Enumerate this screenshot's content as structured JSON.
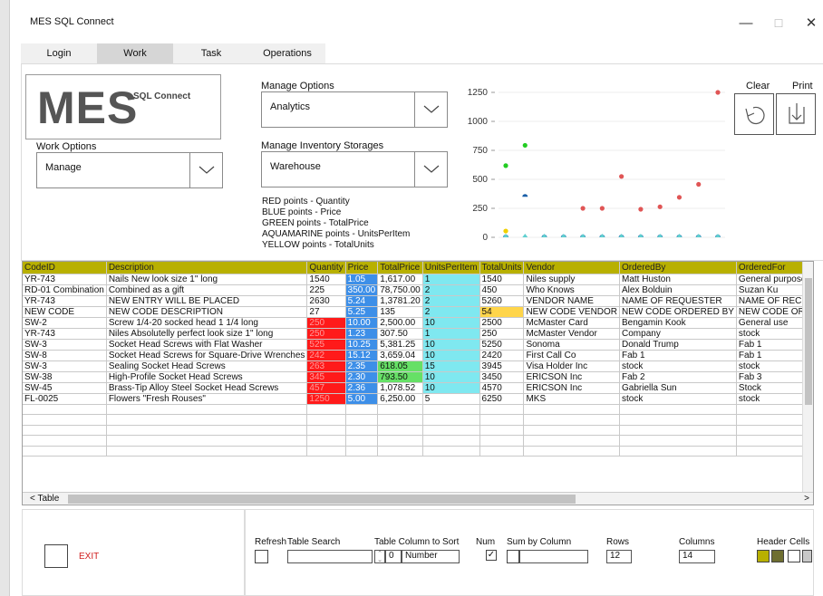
{
  "window": {
    "title": "MES SQL Connect",
    "minimize": "—",
    "maximize": "☐",
    "close": "✕"
  },
  "tabs": [
    {
      "label": "Login"
    },
    {
      "label": "Work"
    },
    {
      "label": "Task"
    },
    {
      "label": "Operations"
    }
  ],
  "logo": {
    "big": "MES",
    "small": "SQL Connect"
  },
  "work_options": {
    "label": "Work Options",
    "value": "Manage"
  },
  "manage_options": {
    "label": "Manage Options",
    "value": "Analytics"
  },
  "manage_storage": {
    "label": "Manage Inventory Storages",
    "value": "Warehouse"
  },
  "legend": [
    "RED points - Quantity",
    "BLUE points - Price",
    "GREEN points - TotalPrice",
    "AQUAMARINE points - UnitsPerItem",
    "YELLOW points - TotalUnits"
  ],
  "chart_data": {
    "type": "scatter",
    "y_ticks": [
      "1250",
      "1000",
      "750",
      "500",
      "250",
      "0"
    ],
    "ylim": [
      0,
      1250
    ],
    "series": [
      {
        "name": "Quantity",
        "color": "#e05555",
        "values": [
          250,
          250,
          525,
          242,
          263,
          345,
          457,
          1250
        ]
      },
      {
        "name": "Price",
        "color": "#1a5fa8",
        "values": [
          1.05,
          350,
          5.24,
          5.25,
          10.0,
          1.23,
          10.25,
          15.12,
          2.35,
          2.3,
          2.36,
          5.0
        ]
      },
      {
        "name": "TotalPrice",
        "color": "#22cc22",
        "values": [
          618.05,
          793.5
        ]
      },
      {
        "name": "UnitsPerItem",
        "color": "#5fd0d0",
        "values": [
          1,
          2,
          2,
          2,
          10,
          1,
          10,
          10,
          15,
          10,
          10,
          5
        ]
      },
      {
        "name": "TotalUnits",
        "color": "#f0d000",
        "values": [
          54
        ]
      }
    ]
  },
  "actions": {
    "clear_label": "Clear",
    "print_label": "Print"
  },
  "table": {
    "columns": [
      "CodeID",
      "Description",
      "Quantity",
      "Price",
      "TotalPrice",
      "UnitsPerItem",
      "TotalUnits",
      "Vendor",
      "OrderedBy",
      "OrderedFor"
    ],
    "rows": [
      [
        "YR-743",
        "Nails New look size 1\" long",
        "1540",
        "1.05",
        "1,617.00",
        "1",
        "1540",
        "Niles supply",
        "Matt Huston",
        "General purposes"
      ],
      [
        "RD-01 Combination",
        "Combined as a gift",
        "225",
        "350.00",
        "78,750.00",
        "2",
        "450",
        "Who Knows",
        "Alex Bolduin",
        "Suzan Ku"
      ],
      [
        "YR-743",
        "NEW ENTRY WILL BE PLACED",
        "2630",
        "5.24",
        "1,3781.20",
        "2",
        "5260",
        "VENDOR NAME",
        "NAME OF REQUESTER",
        "NAME OF RECEPIEN"
      ],
      [
        "NEW CODE",
        "NEW CODE DESCRIPTION",
        "27",
        "5.25",
        "135",
        "2",
        "54",
        "NEW CODE VENDOR",
        "NEW CODE ORDERED BY",
        "NEW CODE ORDERE"
      ],
      [
        "SW-2",
        "Screw 1/4-20 socked head  1 1/4 long",
        "250",
        "10.00",
        "2,500.00",
        "10",
        "2500",
        "McMaster Card",
        "Bengamin Kook",
        "General use"
      ],
      [
        "YR-743",
        "Niles Absolutelly perfect look size 1\" long",
        "250",
        "1.23",
        "307.50",
        "1",
        "250",
        "McMaster Vendor",
        "Company",
        "stock"
      ],
      [
        "SW-3",
        "Socket Head Screws with Flat Washer",
        "525",
        "10.25",
        "5,381.25",
        "10",
        "5250",
        "Sonoma",
        "Donald Trump",
        "Fab 1"
      ],
      [
        "SW-8",
        "Socket Head Screws for Square-Drive Wrenches",
        "242",
        "15.12",
        "3,659.04",
        "10",
        "2420",
        "First Call Co",
        "Fab 1",
        "Fab 1"
      ],
      [
        "SW-3",
        "Sealing Socket Head Screws",
        "263",
        "2.35",
        "618.05",
        "15",
        "3945",
        "Visa Holder Inc",
        "stock",
        "stock"
      ],
      [
        "SW-38",
        "High-Profile Socket Head Screws",
        "345",
        "2.30",
        "793.50",
        "10",
        "3450",
        "ERICSON Inc",
        "Fab 2",
        "Fab 3"
      ],
      [
        "SW-45",
        "Brass-Tip Alloy Steel Socket Head Screws",
        "457",
        "2.36",
        "1,078.52",
        "10",
        "4570",
        "ERICSON Inc",
        "Gabriella Sun",
        "Stock"
      ],
      [
        "FL-0025",
        "Flowers \"Fresh Rouses\"",
        "1250",
        "5.00",
        "6,250.00",
        "5",
        "6250",
        "MKS",
        "stock",
        "stock"
      ]
    ],
    "empty_rows": 5,
    "scroll_label": "< Table",
    "scroll_right": ">",
    "colors": {
      "header": "#b8b000",
      "red": "#ff1a1a",
      "blue": "#3d8fe8",
      "green": "#66e066",
      "aqua": "#7fe8f0",
      "yellow": "#ffd54a"
    }
  },
  "bottom": {
    "exit_label": "EXIT",
    "refresh_label": "Refresh",
    "table_search_label": "Table Search",
    "table_search_value": "",
    "sort_label": "Table Column to Sort",
    "sort_index": "0",
    "sort_column": "Number",
    "num_label": "Num",
    "sum_label": "Sum by Column",
    "sum_value": "",
    "rows_label": "Rows",
    "rows_value": "12",
    "columns_label": "Columns",
    "columns_value": "14",
    "header_label": "Header",
    "cells_label": "Cells",
    "swatch_colors": [
      "#b8b000",
      "#6e6e30",
      "#ffffff",
      "#c8c8c8"
    ]
  }
}
